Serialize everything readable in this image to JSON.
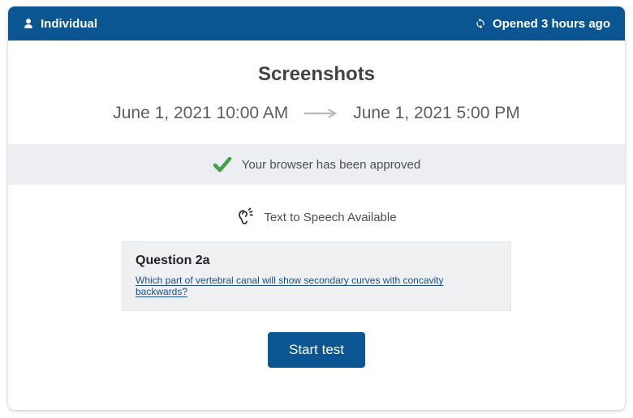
{
  "header": {
    "mode_label": "Individual",
    "opened_label": "Opened 3 hours ago"
  },
  "title": "Screenshots",
  "window": {
    "start": "June 1, 2021 10:00 AM",
    "end": "June 1, 2021 5:00 PM"
  },
  "approval_text": "Your browser has been approved",
  "tts_text": "Text to Speech Available",
  "question": {
    "label": "Question 2a",
    "text": "Which part of vertebral canal will show secondary curves with concavity backwards?"
  },
  "start_button": "Start test"
}
